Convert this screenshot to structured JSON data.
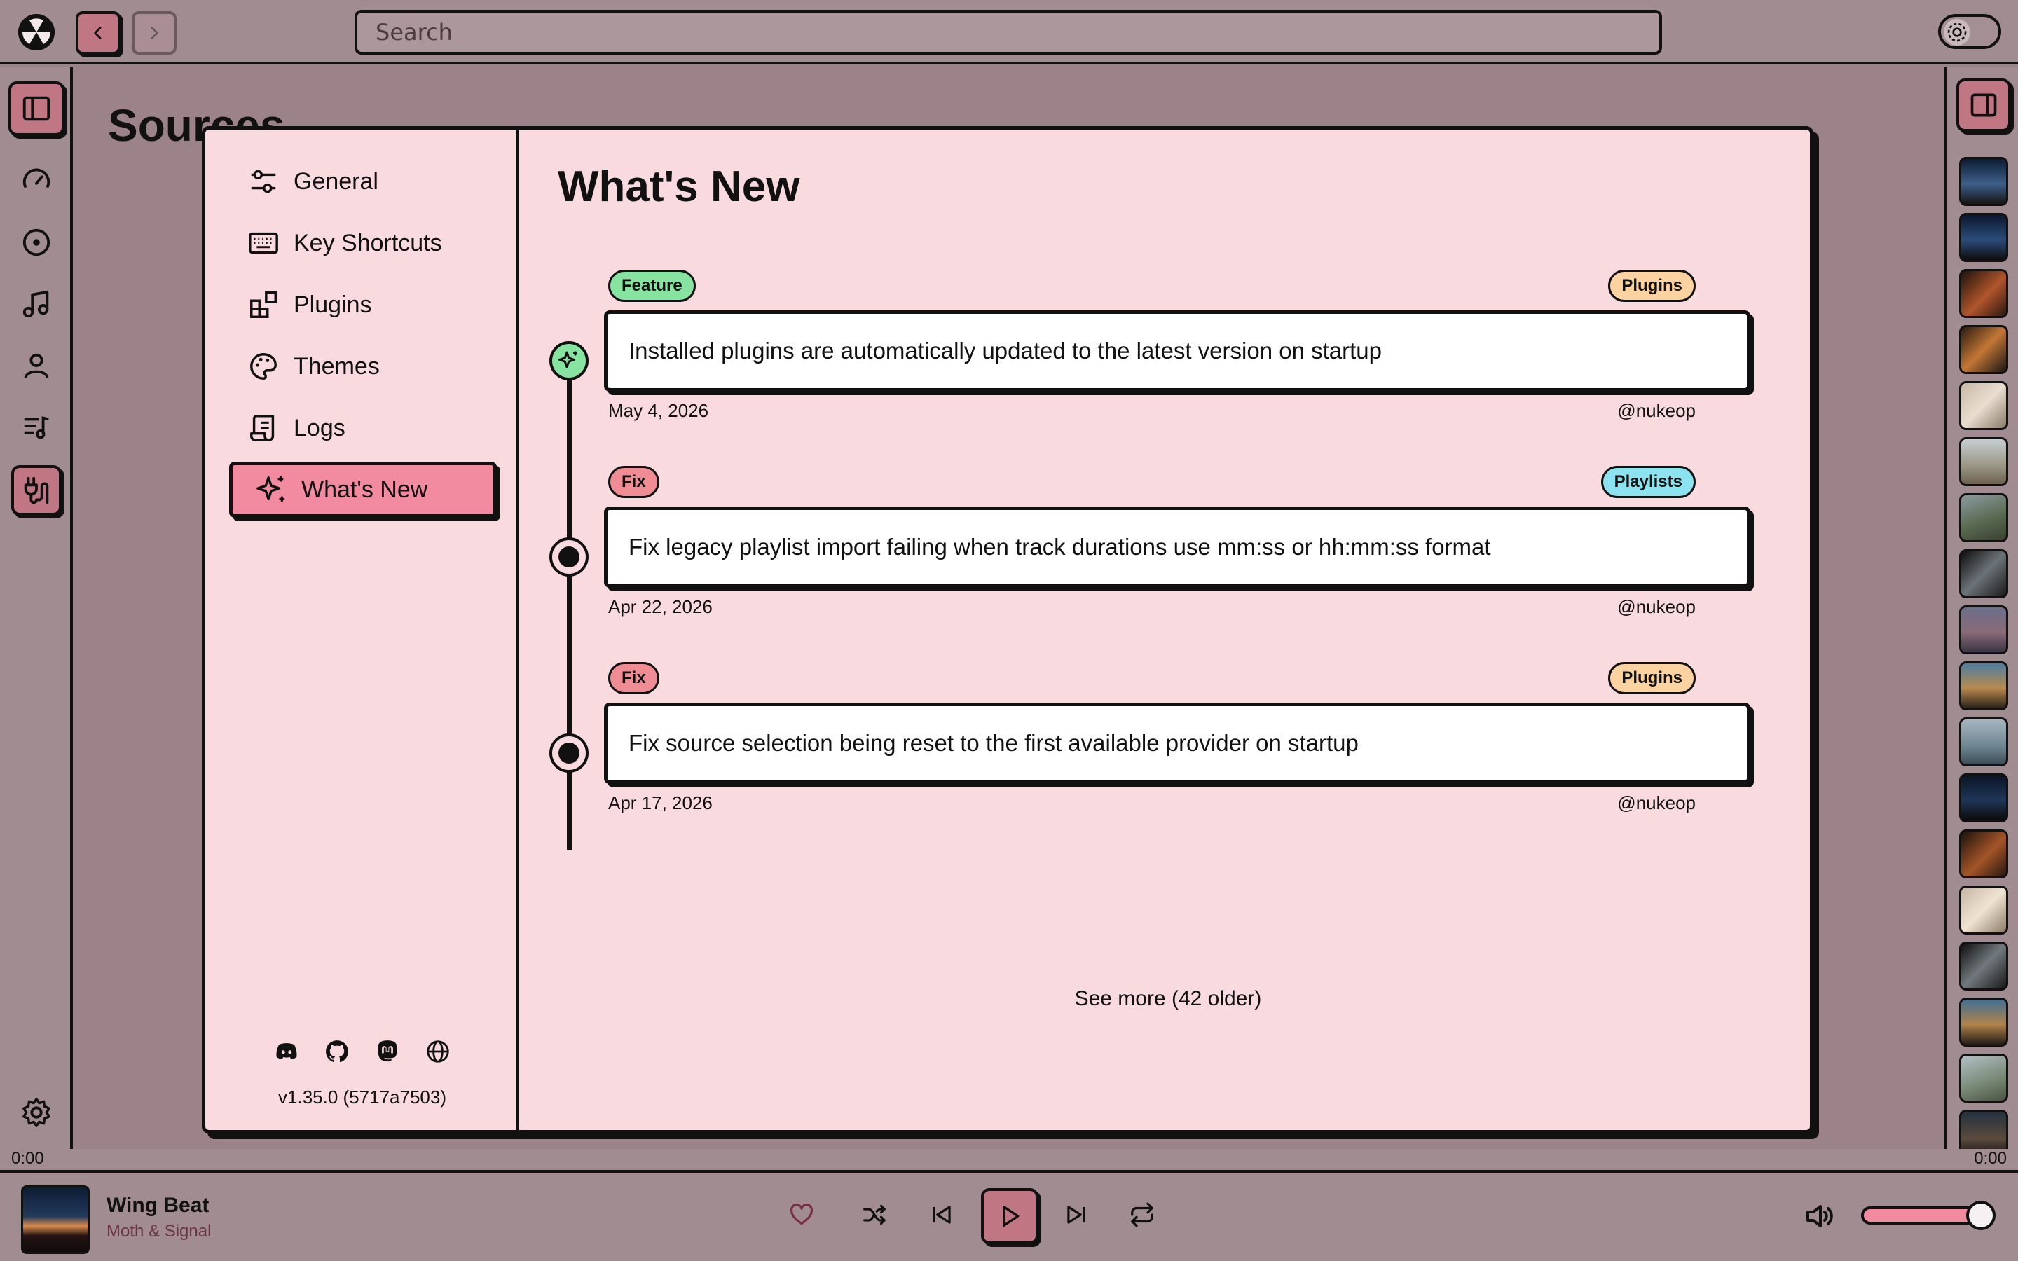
{
  "header": {
    "search_placeholder": "Search"
  },
  "page": {
    "heading": "Sources"
  },
  "settings": {
    "menu": [
      {
        "label": "General",
        "icon": "sliders-icon"
      },
      {
        "label": "Key Shortcuts",
        "icon": "keyboard-icon"
      },
      {
        "label": "Plugins",
        "icon": "plugins-icon"
      },
      {
        "label": "Themes",
        "icon": "palette-icon"
      },
      {
        "label": "Logs",
        "icon": "scroll-icon"
      },
      {
        "label": "What's New",
        "icon": "sparkles-icon",
        "active": true
      }
    ],
    "social_icons": [
      "discord-icon",
      "github-icon",
      "mastodon-icon",
      "globe-icon"
    ],
    "version": "v1.35.0 (5717a7503)"
  },
  "whats_new": {
    "title": "What's New",
    "entries": [
      {
        "type": "Feature",
        "area": "Plugins",
        "text": "Installed plugins are automatically updated to the latest version on startup",
        "date": "May 4, 2026",
        "author": "@nukeop"
      },
      {
        "type": "Fix",
        "area": "Playlists",
        "text": "Fix legacy playlist import failing when track durations use mm:ss or hh:mm:ss format",
        "date": "Apr 22, 2026",
        "author": "@nukeop"
      },
      {
        "type": "Fix",
        "area": "Plugins",
        "text": "Fix source selection being reset to the first available provider on startup",
        "date": "Apr 17, 2026",
        "author": "@nukeop"
      }
    ],
    "see_more": "See more (42 older)"
  },
  "colors": {
    "feature_tag": "#86e3a0",
    "fix_tag": "#f08c94",
    "plugins_tag": "#fcd3a0",
    "playlists_tag": "#8be3f0",
    "accent": "#f38ba0",
    "modal_bg": "#f9dade"
  },
  "progress": {
    "elapsed": "0:00",
    "remaining": "0:00"
  },
  "player": {
    "track_title": "Wing Beat",
    "track_artist": "Moth & Signal",
    "volume_level": 0.9
  }
}
